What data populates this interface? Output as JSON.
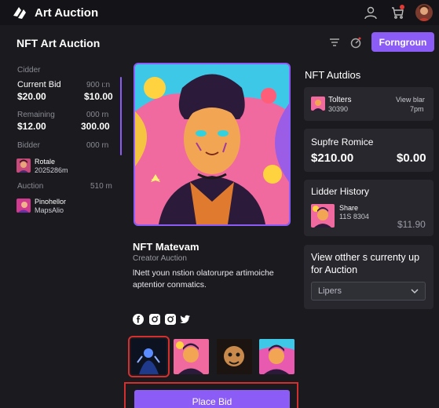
{
  "app": {
    "brand": "Art Auction"
  },
  "header": {
    "title": "NFT Art Auction",
    "primary_button": "Forngroun"
  },
  "left": {
    "row1_label": "Cidder",
    "current_bid_label": "Current Bid",
    "current_bid_meta": "900 ι:n",
    "current_bid_value": "$20.00",
    "current_bid_value2": "$10.00",
    "remaining_label": "Remaining",
    "remaining_meta": "000 rn",
    "remaining_value": "$12.00",
    "remaining_value2": "300.00",
    "bidder_label": "Bidder",
    "bidder_meta": "000 rn",
    "bidder_name": "Rotale",
    "bidder_date": "2025286m",
    "auction_label": "Auction",
    "auction_meta": "510 m",
    "auction_item_name": "Pinohellor",
    "auction_item_sub": "MapsAlio"
  },
  "nft": {
    "title": "NFT Matevam",
    "creator": "Creator Auction",
    "description": "lNett youn nstion olatorurpe artimoiche aptentior conmatics."
  },
  "right": {
    "heading": "NFT Autdios",
    "card1_title": "Tolters",
    "card1_sub": "30390",
    "card1_link": "View blar",
    "card1_time": "7pm",
    "card2_title": "Supfre Romice",
    "card2_price": "$210.00",
    "card2_price2": "$0.00",
    "card3_title": "Lidder History",
    "card3_item_title": "Share",
    "card3_item_sub": "11S 8304",
    "card3_price": "$11.90",
    "card4_title": "View otther s currenty up for Auction",
    "card4_select": "Lipers"
  },
  "actions": {
    "place_bid": "Place Bid"
  },
  "colors": {
    "accent": "#8b5cf6",
    "background": "#1a1a1f",
    "card": "#27272d",
    "highlight": "#d32f2f"
  }
}
